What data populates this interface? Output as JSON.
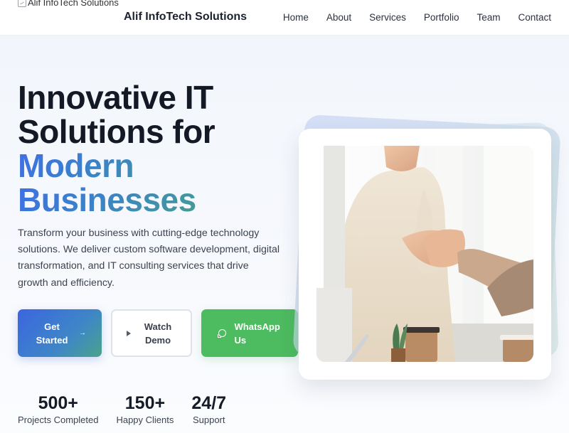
{
  "header": {
    "logo_alt": "Alif InfoTech Solutions",
    "brand_name": "Alif InfoTech Solutions",
    "nav": [
      "Home",
      "About",
      "Services",
      "Portfolio",
      "Team",
      "Contact"
    ]
  },
  "hero": {
    "title_line1": "Innovative IT",
    "title_line2": "Solutions for",
    "title_line3": "Modern",
    "title_line4": "Businesses",
    "description": "Transform your business with cutting-edge technology solutions. We deliver custom software development, digital transformation, and IT consulting services that drive growth and efficiency.",
    "buttons": {
      "get_started": "Get Started",
      "watch_demo": "Watch Demo",
      "whatsapp": "WhatsApp Us"
    },
    "stats": [
      {
        "value": "500+",
        "label": "Projects Completed"
      },
      {
        "value": "150+",
        "label": "Happy Clients"
      },
      {
        "value": "24/7",
        "label": "Support"
      }
    ]
  },
  "colors": {
    "accent_gradient_start": "#3b66e0",
    "accent_gradient_end": "#4aa38c",
    "whatsapp_green": "#4dbb5f"
  },
  "icons": {
    "get_started": "arrow-right-icon",
    "watch_demo": "play-icon",
    "whatsapp": "whatsapp-icon"
  }
}
